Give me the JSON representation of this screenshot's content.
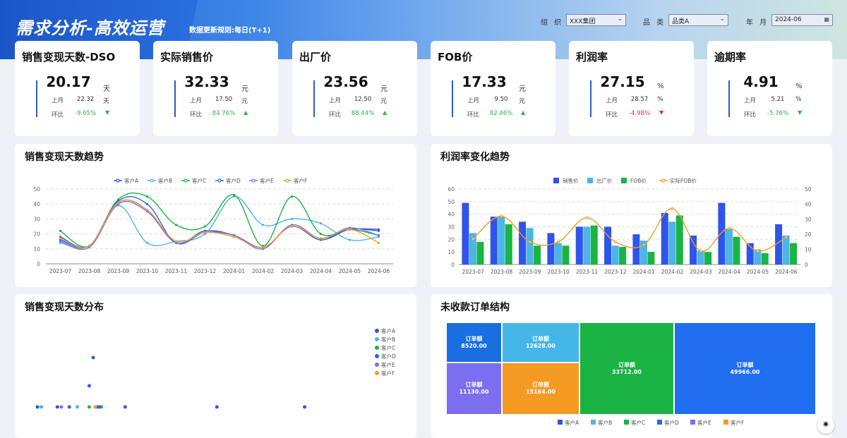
{
  "header": {
    "title": "需求分析-高效运营",
    "update_rule": "数据更新规则:每日(T+1)",
    "filters": [
      {
        "label": "组 织",
        "value": "XXX集团",
        "icon": "chevron-down-icon"
      },
      {
        "label": "品 类",
        "value": "品类A",
        "icon": "chevron-down-icon"
      },
      {
        "label": "年 月",
        "value": "2024-06",
        "icon": "calendar-icon"
      }
    ]
  },
  "kpis": [
    {
      "title": "销售变现天数-DSO",
      "value": "20.17",
      "unit": "天",
      "last_label": "上月",
      "last_value": "22.32",
      "last_unit": "天",
      "ratio_label": "环比",
      "ratio": "-9.65%",
      "ratio_color": "#2fb344",
      "direction": "down"
    },
    {
      "title": "实际销售价",
      "value": "32.33",
      "unit": "元",
      "last_label": "上月",
      "last_value": "17.50",
      "last_unit": "元",
      "ratio_label": "环比",
      "ratio": "84.76%",
      "ratio_color": "#2fb344",
      "direction": "up"
    },
    {
      "title": "出厂价",
      "value": "23.56",
      "unit": "元",
      "last_label": "上月",
      "last_value": "12.50",
      "last_unit": "元",
      "ratio_label": "环比",
      "ratio": "88.44%",
      "ratio_color": "#2fb344",
      "direction": "up"
    },
    {
      "title": "FOB价",
      "value": "17.33",
      "unit": "元",
      "last_label": "上月",
      "last_value": "9.50",
      "last_unit": "元",
      "ratio_label": "环比",
      "ratio": "82.46%",
      "ratio_color": "#2fb344",
      "direction": "up"
    },
    {
      "title": "利润率",
      "value": "27.15",
      "unit": "%",
      "last_label": "上月",
      "last_value": "28.57",
      "last_unit": "%",
      "ratio_label": "环比",
      "ratio": "-4.98%",
      "ratio_color": "#e5322d",
      "direction": "down"
    },
    {
      "title": "逾期率",
      "value": "4.91",
      "unit": "%",
      "last_label": "上月",
      "last_value": "5.21",
      "last_unit": "%",
      "ratio_label": "环比",
      "ratio": "-5.76%",
      "ratio_color": "#2fb344",
      "direction": "down"
    }
  ],
  "chart_data": [
    {
      "id": "dso_trend",
      "type": "line",
      "title": "销售变现天数趋势",
      "x": [
        "2023-07",
        "2023-08",
        "2023-09",
        "2023-10",
        "2023-11",
        "2023-12",
        "2024-01",
        "2024-02",
        "2024-03",
        "2024-04",
        "2024-05",
        "2024-06"
      ],
      "ylim": [
        0,
        50
      ],
      "yticks": [
        0,
        10,
        20,
        30,
        40,
        50
      ],
      "legend_position": "top-center",
      "grid": true,
      "series": [
        {
          "name": "客户A",
          "color": "#2f54eb",
          "values": [
            16,
            12,
            41,
            36,
            14,
            22,
            19,
            11,
            25,
            17,
            23,
            23
          ]
        },
        {
          "name": "客户B",
          "color": "#4cb5e6",
          "values": [
            14,
            12,
            39,
            14,
            15,
            20,
            45,
            26,
            30,
            27,
            16,
            18
          ]
        },
        {
          "name": "客户C",
          "color": "#19b443",
          "values": [
            22,
            12,
            43,
            45,
            26,
            25,
            46,
            12,
            45,
            20,
            23,
            19
          ]
        },
        {
          "name": "客户D",
          "color": "#2f62e6",
          "values": [
            18,
            12,
            42,
            40,
            14,
            21,
            19,
            11,
            25,
            16,
            23,
            22
          ]
        },
        {
          "name": "客户E",
          "color": "#7b6ff0",
          "values": [
            15,
            11,
            40,
            35,
            14,
            21,
            19,
            10,
            26,
            17,
            24,
            19
          ]
        },
        {
          "name": "客户F",
          "color": "#f59a23",
          "values": [
            17,
            12,
            41,
            36,
            15,
            21,
            18,
            11,
            25,
            17,
            23,
            14
          ]
        }
      ]
    },
    {
      "id": "margin_trend",
      "type": "bar",
      "title": "利润率变化趋势",
      "categories": [
        "2023-07",
        "2023-08",
        "2023-09",
        "2023-10",
        "2023-11",
        "2023-12",
        "2024-01",
        "2024-02",
        "2024-03",
        "2024-04",
        "2024-05",
        "2024-06"
      ],
      "ylim_left": [
        0,
        60
      ],
      "yticks_left": [
        0,
        10,
        20,
        30,
        40,
        50,
        60
      ],
      "ylim_right": [
        0,
        50
      ],
      "yticks_right": [
        0,
        10,
        20,
        30,
        40,
        50
      ],
      "legend_position": "top-center",
      "series": [
        {
          "name": "销售价",
          "kind": "bar",
          "color": "#2f54eb",
          "values": [
            49,
            38,
            34,
            25,
            30,
            30,
            24,
            41,
            23,
            49,
            17,
            32
          ]
        },
        {
          "name": "出厂价",
          "kind": "bar",
          "color": "#4cb5e6",
          "values": [
            25,
            38,
            29,
            17,
            30,
            15,
            19,
            34,
            11,
            28,
            12,
            23
          ]
        },
        {
          "name": "FOB价",
          "kind": "bar",
          "color": "#19b443",
          "values": [
            18,
            32,
            15,
            15,
            31,
            14,
            10,
            39,
            10,
            22,
            9,
            17
          ]
        },
        {
          "name": "实际FOB价",
          "kind": "line",
          "axis": "right",
          "color": "#f59a23",
          "values": [
            17,
            32,
            15,
            15,
            31,
            15,
            13,
            37,
            9,
            24,
            9,
            18
          ]
        }
      ]
    },
    {
      "id": "dso_distribution",
      "type": "scatter",
      "title": "销售变现天数分布",
      "legend_position": "right",
      "series": [
        {
          "name": "客户A",
          "color": "#2f54eb",
          "points": [
            [
              0,
              0
            ],
            [
              5,
              0
            ],
            [
              22,
              0
            ],
            [
              45,
              0
            ],
            [
              67,
              0
            ]
          ]
        },
        {
          "name": "客户B",
          "color": "#4cb5e6",
          "points": [
            [
              1,
              0
            ],
            [
              10,
              0
            ]
          ]
        },
        {
          "name": "客户C",
          "color": "#19b443",
          "points": [
            [
              13,
              0
            ],
            [
              16,
              0
            ]
          ]
        },
        {
          "name": "客户D",
          "color": "#2f62e6",
          "points": [
            [
              8,
              0
            ],
            [
              15,
              0
            ],
            [
              15.5,
              0
            ],
            [
              13,
              1.5
            ],
            [
              14,
              3.5
            ]
          ]
        },
        {
          "name": "客户E",
          "color": "#7b6ff0",
          "points": [
            [
              6,
              0
            ]
          ]
        },
        {
          "name": "客户F",
          "color": "#f59a23",
          "points": [
            [
              14.5,
              0
            ]
          ]
        }
      ]
    }
  ],
  "treemap": {
    "title": "未收款订单结构",
    "cell_label": "订单额",
    "cells": [
      {
        "name": "客户A",
        "value": "8520.00",
        "color": "#1a6ee0"
      },
      {
        "name": "客户B",
        "value": "12628.00",
        "color": "#45b6e8"
      },
      {
        "name": "客户C",
        "value": "33712.00",
        "color": "#19b443"
      },
      {
        "name": "客户D",
        "value": "49966.00",
        "color": "#1f6ef0"
      },
      {
        "name": "客户E",
        "value": "11130.00",
        "color": "#7b6ff0"
      },
      {
        "name": "客户F",
        "value": "15164.00",
        "color": "#f59a23"
      }
    ],
    "legend": [
      {
        "name": "客户A",
        "color": "#2f54eb"
      },
      {
        "name": "客户B",
        "color": "#4cb5e6"
      },
      {
        "name": "客户C",
        "color": "#19b443"
      },
      {
        "name": "客户D",
        "color": "#1f6ef0"
      },
      {
        "name": "客户E",
        "color": "#7b6ff0"
      },
      {
        "name": "客户F",
        "color": "#f59a23"
      }
    ]
  },
  "fab_icon": "bug-icon"
}
